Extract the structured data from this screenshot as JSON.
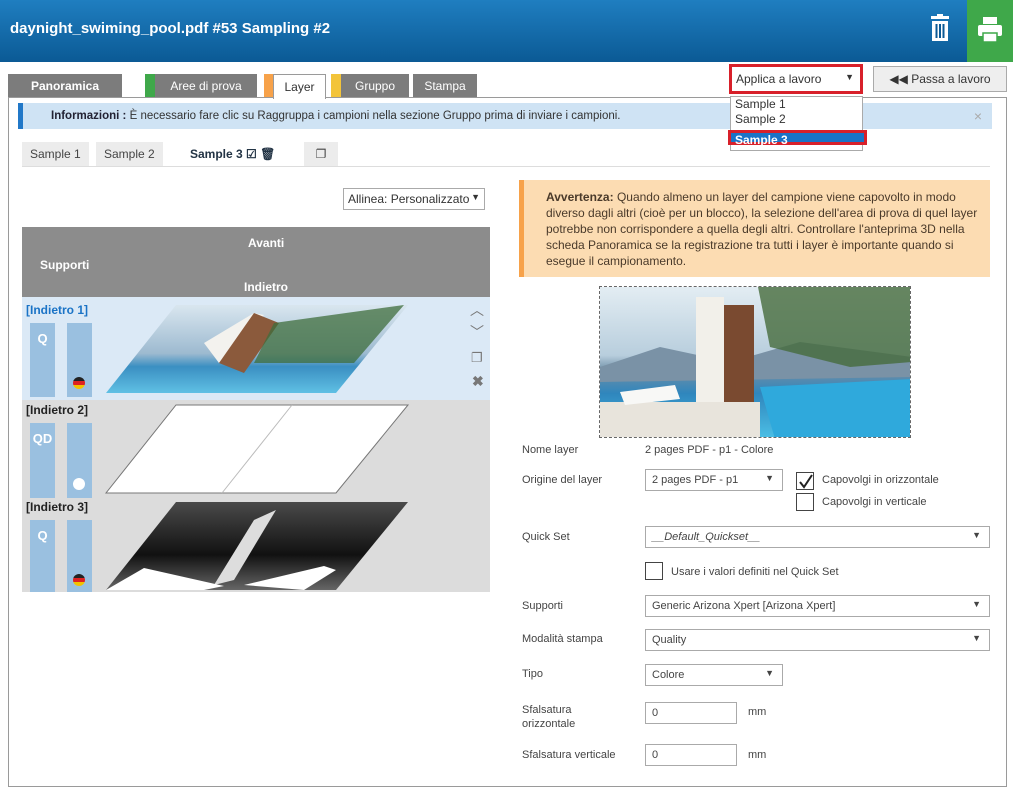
{
  "title": "daynight_swiming_pool.pdf #53 Sampling #2",
  "tabs": [
    "Panoramica",
    "Aree di prova",
    "Layer",
    "Gruppo",
    "Stampa"
  ],
  "apply": {
    "label": "Applica a lavoro",
    "options": [
      "Sample 1",
      "Sample 2",
      "Sample 3"
    ]
  },
  "passa_label": "◀◀ Passa a lavoro",
  "info": {
    "bold": "Informazioni :",
    "text": "È necessario fare clic su Raggruppa i campioni nella sezione Gruppo prima di inviare i campioni.",
    "close": "×"
  },
  "sample_tabs": [
    "Sample 1",
    "Sample 2",
    "Sample 3"
  ],
  "align_label": "Allinea: Personalizzato",
  "layers_header": {
    "supporti": "Supporti",
    "avanti": "Avanti",
    "indietro": "Indietro"
  },
  "layers": [
    {
      "label": "[Indietro 1]",
      "mode": "Q"
    },
    {
      "label": "[Indietro 2]",
      "mode": "QD"
    },
    {
      "label": "[Indietro 3]",
      "mode": "Q"
    }
  ],
  "warning": {
    "bold": "Avvertenza:",
    "text": "Quando almeno un layer del campione viene capovolto in modo diverso dagli altri (cioè per un blocco), la selezione dell'area di prova di quel layer potrebbe non corrispondere a quella degli altri. Controllare l'anteprima 3D nella scheda Panoramica se la registrazione tra tutti i layer è importante quando si esegue il campionamento."
  },
  "form": {
    "nome_layer": {
      "label": "Nome layer",
      "value": "2 pages PDF - p1 - Colore"
    },
    "origine": {
      "label": "Origine del layer",
      "value": "2 pages PDF - p1"
    },
    "flip_h": {
      "label": "Capovolgi in orizzontale",
      "checked": true
    },
    "flip_v": {
      "label": "Capovolgi in verticale",
      "checked": false
    },
    "quickset": {
      "label": "Quick Set",
      "value": "__Default_Quickset__"
    },
    "use_qs": {
      "label": "Usare i valori definiti nel Quick Set",
      "checked": false
    },
    "supporti": {
      "label": "Supporti",
      "value": "Generic Arizona Xpert [Arizona Xpert]"
    },
    "modalita": {
      "label": "Modalità stampa",
      "value": "Quality"
    },
    "tipo": {
      "label": "Tipo",
      "value": "Colore"
    },
    "sfals_o": {
      "label1": "Sfalsatura",
      "label2": "orizzontale",
      "value": "0",
      "unit": "mm"
    },
    "sfals_v": {
      "label": "Sfalsatura verticale",
      "value": "0",
      "unit": "mm"
    }
  },
  "colors": {
    "title_blue": "#0b5a95",
    "print_green": "#3fa84a",
    "tab_green": "#3fa84a",
    "tab_orange": "#f7a24a",
    "tab_yellow": "#f3c43a",
    "highlight_red": "#d8202a",
    "selected_blue": "#1a73c6"
  }
}
